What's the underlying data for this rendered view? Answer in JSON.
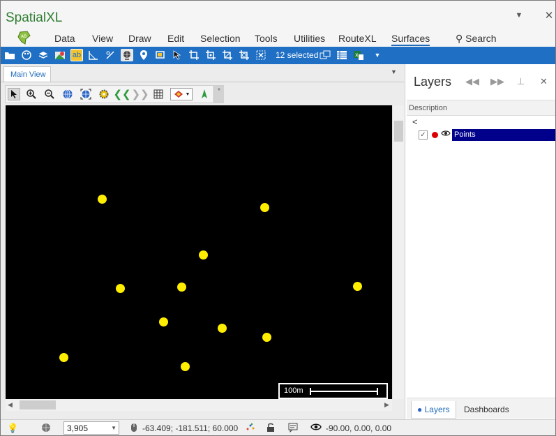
{
  "app": {
    "title": "SpatialXL"
  },
  "menu": {
    "items": [
      "Data",
      "View",
      "Draw",
      "Edit",
      "Selection",
      "Tools",
      "Utilities",
      "RouteXL",
      "Surfaces"
    ],
    "active": "Surfaces",
    "search_label": "Search"
  },
  "ribbon": {
    "selected_text": "12 selected"
  },
  "view": {
    "tab_label": "Main View"
  },
  "map": {
    "background": "#000000",
    "point_color": "#ffee00",
    "points": 12,
    "axis_y": "y",
    "axis_x": "x",
    "scale_label": "100m"
  },
  "layers_panel": {
    "title": "Layers",
    "column_header": "Description",
    "back": "<",
    "layers": [
      {
        "name": "Points",
        "visible": true,
        "checked": true,
        "color": "#dd0000"
      }
    ],
    "tabs": [
      "Layers",
      "Dashboards"
    ]
  },
  "status": {
    "scale_value": "3,905",
    "coordinates": "-63.409; -181.511; 60.000",
    "view_angles": "-90.00, 0.00, 0.00"
  },
  "colors": {
    "accent": "#1f6fc4",
    "title_green": "#2f7d32",
    "selection": "#00008b"
  }
}
